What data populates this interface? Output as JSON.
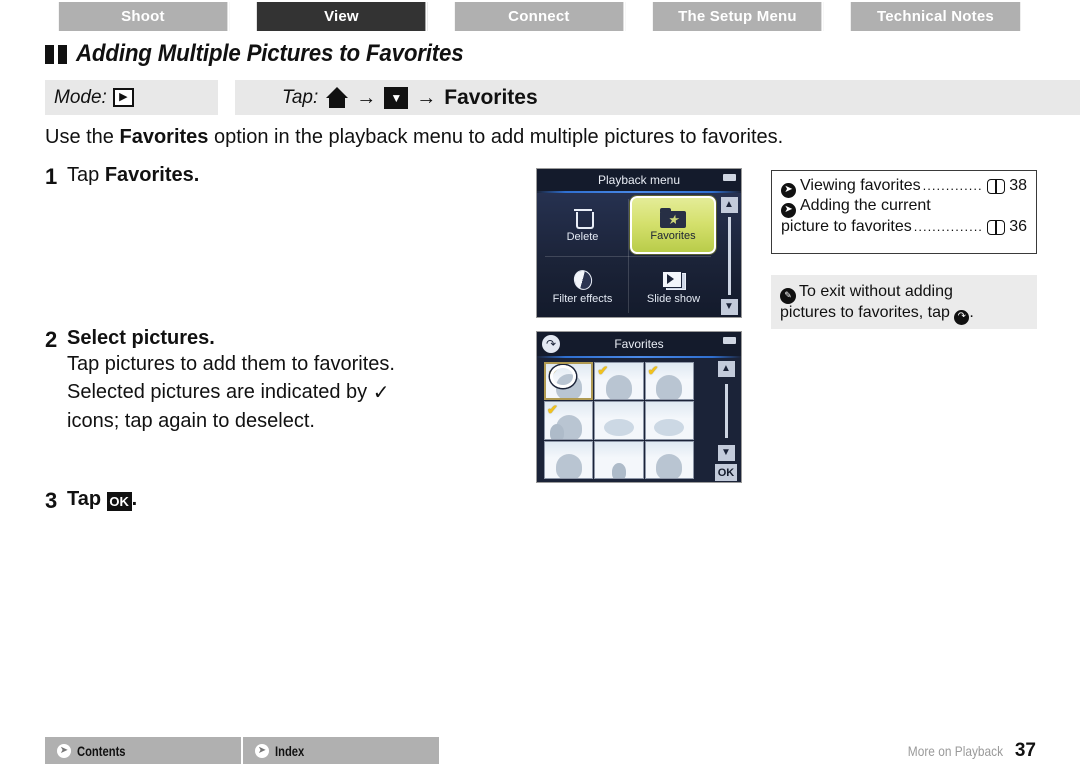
{
  "top_tabs": [
    {
      "label": "Shoot",
      "active": false
    },
    {
      "label": "View",
      "active": true
    },
    {
      "label": "Connect",
      "active": false
    },
    {
      "label": "The Setup Menu",
      "active": false
    },
    {
      "label": "Technical Notes",
      "active": false
    }
  ],
  "section": {
    "title": "Adding Multiple Pictures to Favorites",
    "marker_icon": "double-square-marker-icon"
  },
  "mode_bar": {
    "mode_label": "Mode:",
    "mode_icon": "playback-mode-icon",
    "tap_label": "Tap:",
    "home_icon": "home-icon",
    "arrow": "→",
    "down_icon": "down-triangle-button-icon",
    "target": "Favorites"
  },
  "intro": {
    "before": "Use the ",
    "bold": "Favorites",
    "after": " option in the playback menu to add multiple pictures to favorites."
  },
  "steps": [
    {
      "number": "1",
      "title_plain": "Tap ",
      "title_bold": "Favorites.",
      "lines": []
    },
    {
      "number": "2",
      "title_plain": "",
      "title_bold": "Select pictures.",
      "lines": [
        "Tap pictures to add them to favorites.",
        "Selected pictures are indicated by",
        "icons; tap again to deselect."
      ],
      "inline_icon": "checkmark-icon"
    },
    {
      "number": "3",
      "title_plain": "Tap ",
      "title_bold": "",
      "ok_icon_label": "OK",
      "title_suffix": "."
    }
  ],
  "camera_screen_1": {
    "title": "Playback menu",
    "battery_icon": "battery-icon",
    "items": [
      {
        "label": "Delete",
        "icon": "trash-icon",
        "highlighted": false
      },
      {
        "label": "Favorites",
        "icon": "folder-star-icon",
        "highlighted": true
      },
      {
        "label": "Filter effects",
        "icon": "filter-effects-icon",
        "highlighted": false
      },
      {
        "label": "Slide show",
        "icon": "slide-show-icon",
        "highlighted": false
      }
    ],
    "scroll_up_icon": "scroll-up-icon",
    "scroll_down_icon": "scroll-down-icon",
    "highlight_color": "#d4e06c"
  },
  "camera_screen_2": {
    "title": "Favorites",
    "back_icon": "back-arrow-icon",
    "battery_icon": "battery-icon",
    "ok_label": "OK",
    "scroll_up_icon": "scroll-up-icon",
    "scroll_down_icon": "scroll-down-icon",
    "thumbnails": [
      {
        "index": 1,
        "selected": true,
        "callout": true,
        "type": "person-landscape"
      },
      {
        "index": 2,
        "selected": true,
        "callout": false,
        "type": "portrait"
      },
      {
        "index": 3,
        "selected": true,
        "callout": false,
        "type": "person-bag"
      },
      {
        "index": 4,
        "selected": true,
        "callout": false,
        "type": "two-people"
      },
      {
        "index": 5,
        "selected": false,
        "callout": false,
        "type": "flowers"
      },
      {
        "index": 6,
        "selected": false,
        "callout": false,
        "type": "flowers"
      },
      {
        "index": 7,
        "selected": false,
        "callout": false,
        "type": "portrait"
      },
      {
        "index": 8,
        "selected": false,
        "callout": false,
        "type": "standing-figure"
      },
      {
        "index": 9,
        "selected": false,
        "callout": false,
        "type": "portrait"
      }
    ],
    "check_color": "#f2c21c"
  },
  "reference_box": {
    "entries": [
      {
        "icon": "arrow-circle-icon",
        "text": "Viewing favorites",
        "book_icon": "book-icon",
        "page": "38",
        "wrapped": false
      },
      {
        "icon": "arrow-circle-icon",
        "text": "Adding the current",
        "text2": "picture to favorites",
        "book_icon": "book-icon",
        "page": "36",
        "wrapped": true
      }
    ]
  },
  "note_box": {
    "icon": "pencil-note-icon",
    "line1": "To exit without adding",
    "line2_before": "pictures to favorites, tap",
    "exit_icon": "exit-arrow-icon",
    "line2_after": "."
  },
  "footer": {
    "tabs": [
      {
        "label": "Contents",
        "icon": "arrow-circle-icon"
      },
      {
        "label": "Index",
        "icon": "arrow-circle-icon"
      }
    ],
    "chapter": "More on Playback",
    "page": "37"
  }
}
